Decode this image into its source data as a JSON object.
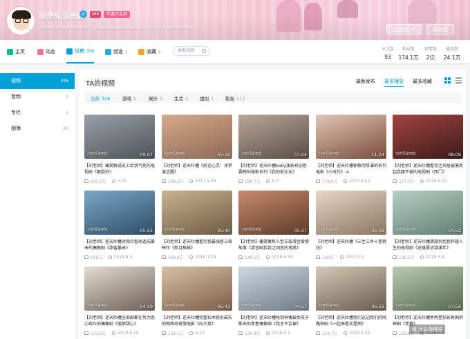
{
  "banner": {
    "username": "刘老师说电影",
    "live_label": "LV6",
    "vip_label": "年度大会员",
    "signature": "定期更新新视频 解说视频 合作：bilibili@liulaoshi-movie.com 点关注 不迷路 哈哈哈哈哈",
    "follow_label": "已关注 ∨",
    "message_label": "发消息"
  },
  "nav": {
    "tabs": [
      {
        "label": "主页",
        "count": "",
        "icon": "home-icon",
        "color": "#00c091"
      },
      {
        "label": "动态",
        "count": "",
        "icon": "dynamic-icon",
        "color": "#fb7299"
      },
      {
        "label": "投稿",
        "count": "356",
        "icon": "upload-icon",
        "color": "#00a1d6"
      },
      {
        "label": "频道",
        "count": "3",
        "icon": "channel-icon",
        "color": "#23ade5"
      },
      {
        "label": "收藏",
        "count": "4",
        "icon": "star-icon",
        "color": "#f3a034"
      }
    ],
    "search_placeholder": "搜索视频",
    "stats": [
      {
        "label": "关注数",
        "value": "93"
      },
      {
        "label": "粉丝数",
        "value": "174.1万"
      },
      {
        "label": "获赞数",
        "value": "2亿"
      },
      {
        "label": "播放数",
        "value": "24.1万"
      }
    ]
  },
  "sidebar": {
    "items": [
      {
        "label": "视频",
        "count": "326"
      },
      {
        "label": "音频",
        "count": "0"
      },
      {
        "label": "专栏",
        "count": "1"
      },
      {
        "label": "相簿",
        "count": "29"
      }
    ]
  },
  "main": {
    "title": "TA的视频",
    "sorts": [
      "最新发布",
      "最多播放",
      "最多收藏"
    ],
    "filters": [
      {
        "label": "全部",
        "count": "326"
      },
      {
        "label": "游戏",
        "count": "5"
      },
      {
        "label": "娱乐",
        "count": "3"
      },
      {
        "label": "生活",
        "count": "4"
      },
      {
        "label": "国创",
        "count": "1"
      },
      {
        "label": "影视",
        "count": "313"
      }
    ],
    "watermark": "刘老师说电影",
    "videos": [
      {
        "dur": "09:07",
        "title": "【刘老师】爆笑解说史上给我气死的电视剧《都挺好》",
        "plays": "245.2万",
        "date": "3-21",
        "bg": [
          "#9aa0a8",
          "#4e5358"
        ]
      },
      {
        "dur": "05:29",
        "title": "【刘老师】逆天吐槽《民话心灵：冰梦演艺圈》",
        "plays": "198.3万",
        "date": "2017-9-29",
        "bg": [
          "#d7a98a",
          "#8c6a55"
        ]
      },
      {
        "dur": "07:24",
        "title": "【刘老师】逆天吐槽baby演技有创意霸榜的电影系列《我的前女友》",
        "plays": "189.7万",
        "date": "6-7",
        "bg": [
          "#b8a79a",
          "#5b4d44"
        ]
      },
      {
        "dur": "11:24",
        "title": "【刘老师】逆天吐槽郭敬明导演的系列电影《小时代》-4",
        "plays": "178.6万",
        "date": "2017-8-23",
        "bg": [
          "#e0c6b6",
          "#7a4d3b"
        ]
      },
      {
        "dur": "08:09",
        "title": "【刘老师】逆天吐槽看完之后居被激笑起我腰不被的电视剧《西门》",
        "plays": "177.7万",
        "date": "2018-5-22",
        "bg": [
          "#a3443f",
          "#3b1b1a"
        ]
      },
      {
        "dur": "05:55",
        "title": "【刘老师】逆天吐槽对观众智商造成暴击的偶像剧《甜蜜暴击》",
        "plays": "158万",
        "date": "2018-8-3",
        "bg": [
          "#7aa7c7",
          "#2f4d66"
        ]
      },
      {
        "dur": "05:40",
        "title": "【刘老师】逆天吐槽看完我最强医三观神作《新月格格》",
        "plays": "149.6万",
        "date": "2018-10-9",
        "bg": [
          "#c9b392",
          "#6e5a40"
        ]
      },
      {
        "dur": "05:37",
        "title": "【刘老师】爆笑聚焦人型古装清宫爱情故事《清宫剧我我之回宫的诱惑》",
        "plays": "148.1万",
        "date": "2018-8-18",
        "bg": [
          "#c98b6a",
          "#5d3a2b"
        ]
      },
      {
        "dur": "05:08",
        "title": "【刘老师】逆天吐槽《三生三世十里桃花》",
        "plays": "140万",
        "date": "2017-3-9",
        "bg": [
          "#e8d6c4",
          "#8a7660"
        ]
      },
      {
        "dur": "04:52",
        "title": "【刘老师】逆天吐槽质疑到到我怀疑人生的电视剧《花落夏初锦溪年》",
        "plays": "135.1万",
        "date": "2018-3-8",
        "bg": [
          "#b7cfc4",
          "#5f7f72"
        ]
      },
      {
        "dur": "04:39",
        "title": "【刘老师】逆天吐槽全部剧都在努力恶心观众的偶像剧《美娘甜心》",
        "plays": "133.2万",
        "date": "2018-6-19",
        "bg": [
          "#e6dcd2",
          "#6b5f56"
        ]
      },
      {
        "dur": "06:43",
        "title": "【刘老师】逆天吐槽完整招木就形磁失的网络奇爱情电影《向大真》",
        "plays": "131.1万",
        "date": "6-20",
        "bg": [
          "#d8c1a9",
          "#7c5d45"
        ]
      },
      {
        "dur": "04:27",
        "title": "【刘老师】逆天吐槽抢到神偶被女孩子鄙夫的青春偶像剧《我才不会被》",
        "plays": "130.4万",
        "date": "2018-5-1",
        "bg": [
          "#cfd8e0",
          "#6e7a86"
        ]
      },
      {
        "dur": "06:58",
        "title": "【刘老师】逆天吐槽我们这边我们的网路神剧《一起来看流星雨》",
        "plays": "124.7万",
        "date": "2018-5-24",
        "bg": [
          "#d6c9b8",
          "#6a5c4d"
        ]
      },
      {
        "dur": "07:56",
        "title": "【刘老师】逆天吐槽男明星狂影再剧的神剧《青春》",
        "plays": "122.8万",
        "date": "2018-3-3",
        "bg": [
          "#b9cbb0",
          "#56684d"
        ]
      }
    ]
  },
  "corner_logo": "值 什么值得买"
}
